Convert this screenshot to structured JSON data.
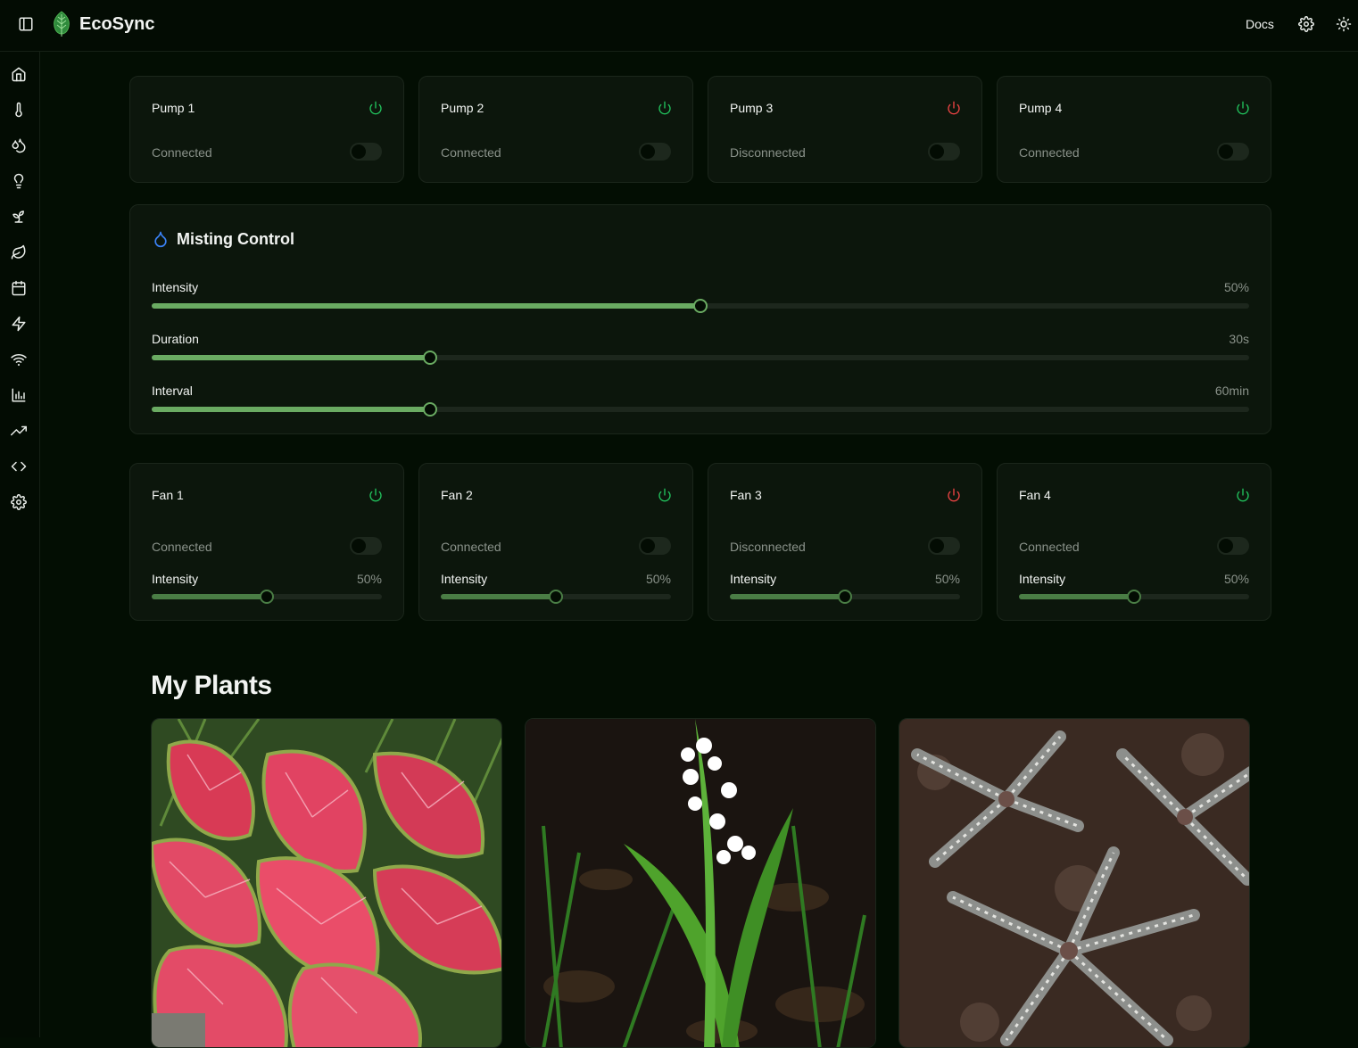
{
  "app": {
    "title": "EcoSync"
  },
  "header": {
    "docs_label": "Docs"
  },
  "sidebar": {
    "items": [
      {
        "icon": "home-icon"
      },
      {
        "icon": "thermometer-icon"
      },
      {
        "icon": "droplets-icon"
      },
      {
        "icon": "lightbulb-icon"
      },
      {
        "icon": "sprout-icon"
      },
      {
        "icon": "leaf-icon"
      },
      {
        "icon": "calendar-icon"
      },
      {
        "icon": "zap-icon"
      },
      {
        "icon": "wifi-icon"
      },
      {
        "icon": "bar-chart-icon"
      },
      {
        "icon": "trending-up-icon"
      },
      {
        "icon": "code-icon"
      },
      {
        "icon": "settings-icon"
      }
    ]
  },
  "pumps": [
    {
      "name": "Pump 1",
      "status": "Connected",
      "power": "on",
      "enabled": false
    },
    {
      "name": "Pump 2",
      "status": "Connected",
      "power": "on",
      "enabled": false
    },
    {
      "name": "Pump 3",
      "status": "Disconnected",
      "power": "off",
      "enabled": false
    },
    {
      "name": "Pump 4",
      "status": "Connected",
      "power": "on",
      "enabled": false
    }
  ],
  "misting": {
    "title": "Misting Control",
    "sliders": [
      {
        "label": "Intensity",
        "value_text": "50%",
        "fraction": 0.5
      },
      {
        "label": "Duration",
        "value_text": "30s",
        "fraction": 0.254
      },
      {
        "label": "Interval",
        "value_text": "60min",
        "fraction": 0.254
      }
    ]
  },
  "fans": [
    {
      "name": "Fan 1",
      "status": "Connected",
      "power": "on",
      "enabled": false,
      "intensity_label": "Intensity",
      "intensity_text": "50%",
      "fraction": 0.5
    },
    {
      "name": "Fan 2",
      "status": "Connected",
      "power": "on",
      "enabled": false,
      "intensity_label": "Intensity",
      "intensity_text": "50%",
      "fraction": 0.5
    },
    {
      "name": "Fan 3",
      "status": "Disconnected",
      "power": "off",
      "enabled": false,
      "intensity_label": "Intensity",
      "intensity_text": "50%",
      "fraction": 0.5
    },
    {
      "name": "Fan 4",
      "status": "Connected",
      "power": "on",
      "enabled": false,
      "intensity_label": "Intensity",
      "intensity_text": "50%",
      "fraction": 0.5
    }
  ],
  "plants": {
    "title": "My Plants"
  },
  "colors": {
    "on": "#22c55e",
    "off": "#ef4444",
    "accent": "#6aab62",
    "misting_icon": "#3b82f6",
    "brand": "#3fa34d"
  }
}
